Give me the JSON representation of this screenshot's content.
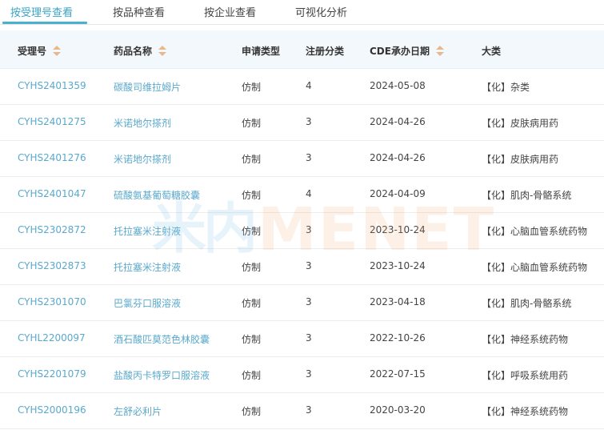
{
  "tabs": [
    {
      "label": "按受理号查看",
      "active": true
    },
    {
      "label": "按品种查看",
      "active": false
    },
    {
      "label": "按企业查看",
      "active": false
    },
    {
      "label": "可视化分析",
      "active": false
    }
  ],
  "table": {
    "headers": {
      "accept_no": "受理号",
      "drug_name": "药品名称",
      "apply_type": "申请类型",
      "reg_class": "注册分类",
      "cde_date": "CDE承办日期",
      "category": "大类"
    },
    "rows": [
      {
        "accept_no": "CYHS2401359",
        "drug_name": "碳酸司维拉姆片",
        "apply_type": "仿制",
        "reg_class": "4",
        "cde_date": "2024-05-08",
        "category": "【化】杂类"
      },
      {
        "accept_no": "CYHS2401275",
        "drug_name": "米诺地尔搽剂",
        "apply_type": "仿制",
        "reg_class": "3",
        "cde_date": "2024-04-26",
        "category": "【化】皮肤病用药"
      },
      {
        "accept_no": "CYHS2401276",
        "drug_name": "米诺地尔搽剂",
        "apply_type": "仿制",
        "reg_class": "3",
        "cde_date": "2024-04-26",
        "category": "【化】皮肤病用药"
      },
      {
        "accept_no": "CYHS2401047",
        "drug_name": "硫酸氨基葡萄糖胶囊",
        "apply_type": "仿制",
        "reg_class": "4",
        "cde_date": "2024-04-09",
        "category": "【化】肌肉-骨骼系统"
      },
      {
        "accept_no": "CYHS2302872",
        "drug_name": "托拉塞米注射液",
        "apply_type": "仿制",
        "reg_class": "3",
        "cde_date": "2023-10-24",
        "category": "【化】心脑血管系统药物"
      },
      {
        "accept_no": "CYHS2302873",
        "drug_name": "托拉塞米注射液",
        "apply_type": "仿制",
        "reg_class": "3",
        "cde_date": "2023-10-24",
        "category": "【化】心脑血管系统药物"
      },
      {
        "accept_no": "CYHS2301070",
        "drug_name": "巴氯芬口服溶液",
        "apply_type": "仿制",
        "reg_class": "3",
        "cde_date": "2023-04-18",
        "category": "【化】肌肉-骨骼系统"
      },
      {
        "accept_no": "CYHL2200097",
        "drug_name": "酒石酸匹莫范色林胶囊",
        "apply_type": "仿制",
        "reg_class": "3",
        "cde_date": "2022-10-26",
        "category": "【化】神经系统药物"
      },
      {
        "accept_no": "CYHS2201079",
        "drug_name": "盐酸丙卡特罗口服溶液",
        "apply_type": "仿制",
        "reg_class": "3",
        "cde_date": "2022-07-15",
        "category": "【化】呼吸系统用药"
      },
      {
        "accept_no": "CYHS2000196",
        "drug_name": "左舒必利片",
        "apply_type": "仿制",
        "reg_class": "3",
        "cde_date": "2020-03-20",
        "category": "【化】神经系统药物"
      }
    ]
  },
  "watermark": {
    "cn": "米内",
    "en": "MENET"
  },
  "colors": {
    "accent": "#4bb0d0",
    "link": "#5aa9cc",
    "header_bg": "#f2f8fc",
    "sort_icon": "#e7b98a"
  }
}
